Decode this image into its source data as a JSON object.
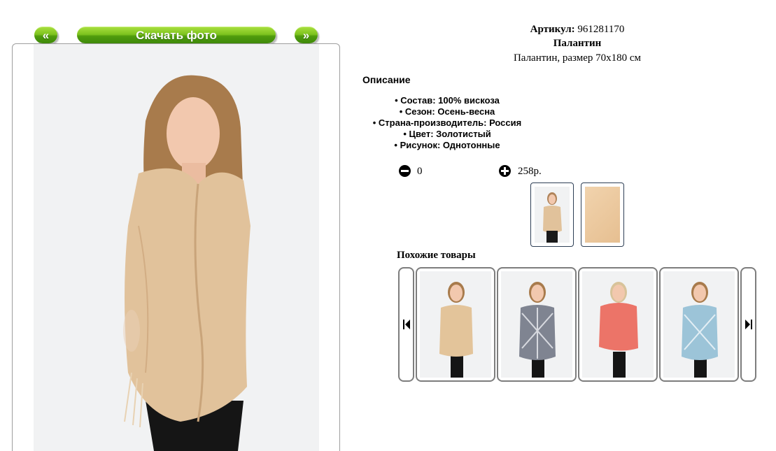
{
  "nav": {
    "prev_label": "«",
    "download_label": "Скачать фото",
    "next_label": "»"
  },
  "product": {
    "article_label": "Артикул:",
    "article_value": "961281170",
    "name": "Палантин",
    "subtitle": "Палантин, размер 70х180 см",
    "description_title": "Описание",
    "properties": [
      "Состав: 100% вискоза",
      "Сезон: Осень-весна",
      "Страна-производитель: Россия",
      "Цвет: Золотистый",
      "Рисунок: Однотонные"
    ],
    "quantity": "0",
    "price": "258р."
  },
  "similar": {
    "title": "Похожие товары",
    "items": [
      {
        "scarf_color": "#e3c49a"
      },
      {
        "scarf_color": "#7f8491"
      },
      {
        "scarf_color": "#ec7468"
      },
      {
        "scarf_color": "#9cc4d8"
      }
    ]
  },
  "colors": {
    "button_green": "#6fb515",
    "main_scarf": "#e1c29b",
    "frame_border": "#9e9e9e"
  }
}
